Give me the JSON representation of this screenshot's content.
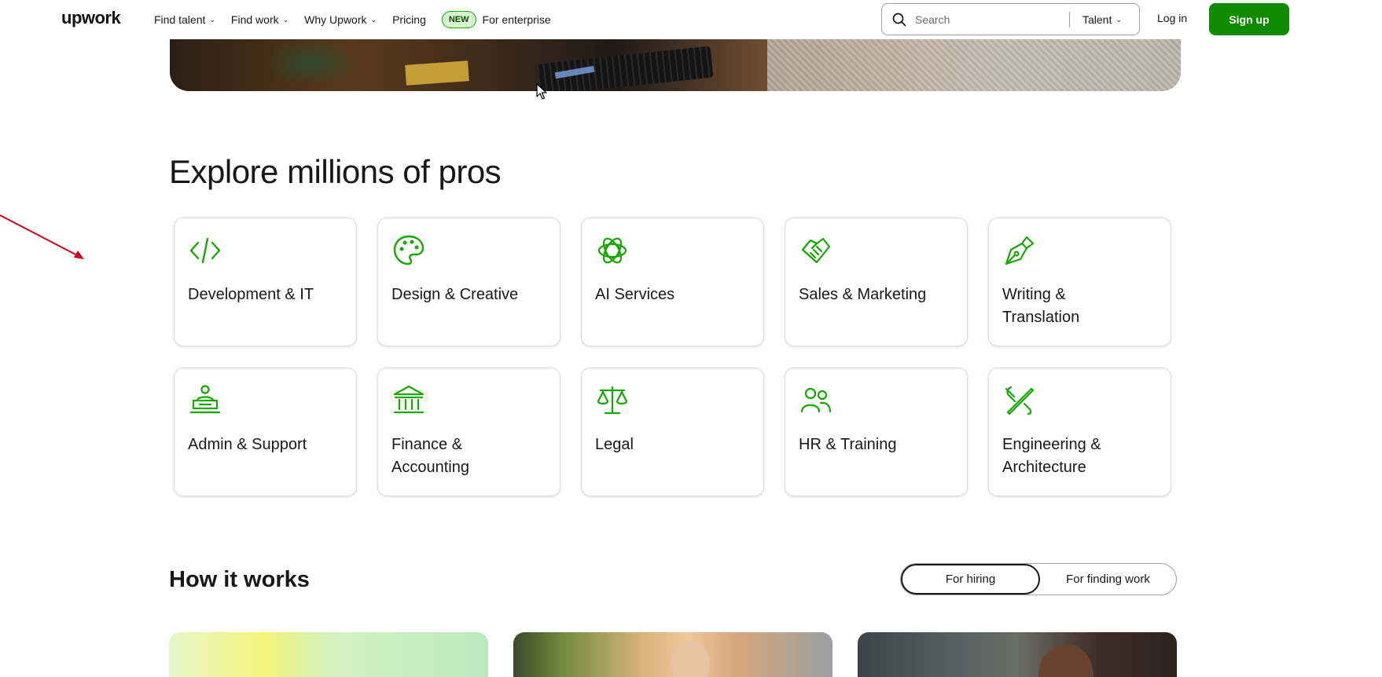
{
  "header": {
    "logo": "upwork",
    "nav": [
      {
        "label": "Find talent",
        "has_dropdown": true
      },
      {
        "label": "Find work",
        "has_dropdown": true
      },
      {
        "label": "Why Upwork",
        "has_dropdown": true
      },
      {
        "label": "Pricing",
        "has_dropdown": false
      }
    ],
    "new_badge": "NEW",
    "enterprise_label": "For enterprise",
    "search": {
      "placeholder": "Search",
      "scope": "Talent"
    },
    "login_label": "Log in",
    "signup_label": "Sign up"
  },
  "explore": {
    "title": "Explore millions of pros",
    "categories": [
      {
        "label": "Development & IT",
        "icon": "code-icon"
      },
      {
        "label": "Design & Creative",
        "icon": "palette-icon"
      },
      {
        "label": "AI Services",
        "icon": "ai-flower-icon"
      },
      {
        "label": "Sales & Marketing",
        "icon": "handshake-icon"
      },
      {
        "label": "Writing & Translation",
        "icon": "pen-nib-icon"
      },
      {
        "label": "Admin & Support",
        "icon": "desk-person-icon"
      },
      {
        "label": "Finance & Accounting",
        "icon": "bank-icon"
      },
      {
        "label": "Legal",
        "icon": "scales-icon"
      },
      {
        "label": "HR & Training",
        "icon": "people-icon"
      },
      {
        "label": "Engineering & Architecture",
        "icon": "tools-icon"
      }
    ]
  },
  "how_it_works": {
    "title": "How it works",
    "toggle": [
      "For hiring",
      "For finding work"
    ],
    "active_toggle": "For hiring"
  },
  "colors": {
    "brand_green": "#108a00",
    "icon_green": "#14a800",
    "text": "#181818",
    "annotation_red": "#d0021b"
  }
}
